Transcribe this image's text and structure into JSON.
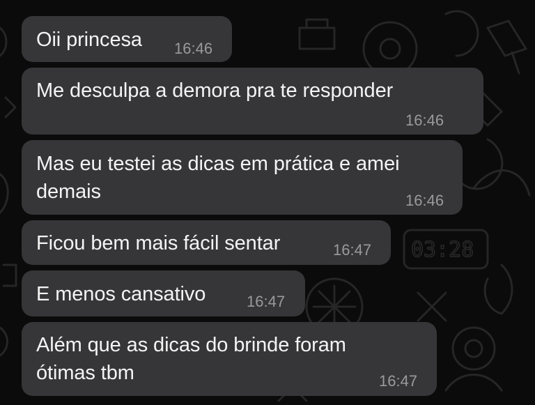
{
  "chat": {
    "messages": [
      {
        "lines": [
          "Oii princesa"
        ],
        "time": "16:46"
      },
      {
        "lines": [
          "Me desculpa a demora pra te responder"
        ],
        "time": "16:46"
      },
      {
        "lines": [
          "Mas eu testei as dicas em prática e amei",
          "demais"
        ],
        "time": "16:46"
      },
      {
        "lines": [
          "Ficou bem mais fácil sentar"
        ],
        "time": "16:47"
      },
      {
        "lines": [
          "E menos cansativo"
        ],
        "time": "16:47"
      },
      {
        "lines": [
          "Além que as dicas do brinde foram",
          "ótimas tbm"
        ],
        "time": "16:47"
      }
    ],
    "wallpaper_clock": "03:28"
  },
  "colors": {
    "background": "#0b0b0b",
    "bubble": "#363638",
    "text": "#f4f4f4",
    "timestamp": "#9a9a9e"
  }
}
